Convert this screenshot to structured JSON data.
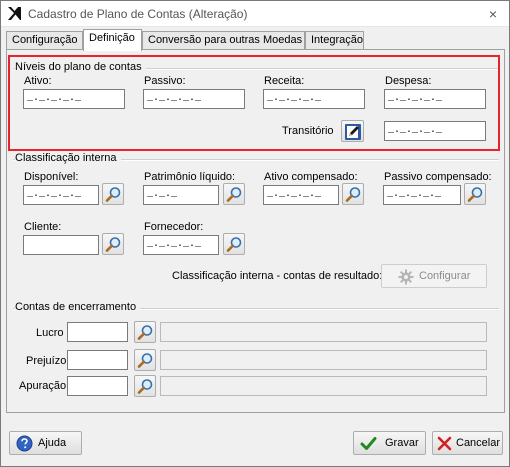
{
  "window": {
    "title": "Cadastro de Plano de Contas (Alteração)",
    "close_symbol": "×"
  },
  "tabs": [
    {
      "label": "Configuração"
    },
    {
      "label": "Definição"
    },
    {
      "label": "Conversão para outras Moedas"
    },
    {
      "label": "Integração"
    }
  ],
  "niveis": {
    "title": "Níveis do plano de contas",
    "ativo_label": "Ativo:",
    "ativo_value": "_._._._._",
    "passivo_label": "Passivo:",
    "passivo_value": "_._._._._",
    "receita_label": "Receita:",
    "receita_value": "_._._._._",
    "despesa_label": "Despesa:",
    "despesa_value": "_._._._._",
    "transitorio_label": "Transitório",
    "transitorio_value": "_._._._._"
  },
  "classificacao": {
    "title": "Classificação interna",
    "disponivel_label": "Disponível:",
    "disponivel_value": "_._._._._",
    "patrimonio_label": "Patrimônio líquido:",
    "patrimonio_value": "_._._",
    "ativo_comp_label": "Ativo compensado:",
    "ativo_comp_value": "_._._._._",
    "passivo_comp_label": "Passivo compensado:",
    "passivo_comp_value": "_._._._._",
    "cliente_label": "Cliente:",
    "cliente_value": "",
    "fornecedor_label": "Fornecedor:",
    "fornecedor_value": "_._._._._",
    "resultado_label": "Classificação interna - contas de resultado:",
    "configurar_label": "Configurar"
  },
  "encerramento": {
    "title": "Contas de encerramento",
    "lucro_label": "Lucro",
    "prejuizo_label": "Prejuízo",
    "apuracao_label": "Apuração"
  },
  "footer": {
    "ajuda_label": "Ajuda",
    "gravar_label": "Gravar",
    "cancelar_label": "Cancelar"
  }
}
